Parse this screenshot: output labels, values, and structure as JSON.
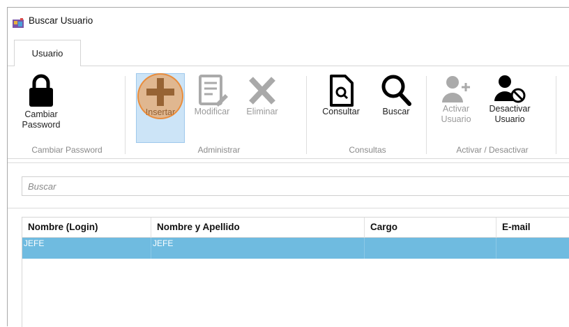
{
  "window": {
    "title": "Buscar Usuario"
  },
  "tabs": [
    {
      "label": "Usuario"
    }
  ],
  "ribbon": {
    "groups": [
      {
        "label": "Cambiar Password",
        "buttons": [
          {
            "label1": "Cambiar",
            "label2": "Password",
            "icon": "lock-icon"
          }
        ]
      },
      {
        "label": "Administrar",
        "buttons": [
          {
            "label": "Insertar",
            "icon": "plus-icon",
            "state": "selected"
          },
          {
            "label": "Modificar",
            "icon": "edit-icon",
            "state": "disabled"
          },
          {
            "label": "Eliminar",
            "icon": "close-icon",
            "state": "disabled"
          }
        ]
      },
      {
        "label": "Consultas",
        "buttons": [
          {
            "label": "Consultar",
            "icon": "document-search-icon"
          },
          {
            "label": "Buscar",
            "icon": "search-icon"
          }
        ]
      },
      {
        "label": "Activar / Desactivar",
        "buttons": [
          {
            "label1": "Activar",
            "label2": "Usuario",
            "icon": "user-add-icon",
            "state": "disabled"
          },
          {
            "label1": "Desactivar",
            "label2": "Usuario",
            "icon": "user-block-icon"
          }
        ]
      }
    ]
  },
  "search": {
    "placeholder": "Buscar",
    "value": ""
  },
  "table": {
    "columns": [
      "Nombre (Login)",
      "Nombre y Apellido",
      "Cargo",
      "E-mail"
    ],
    "rows": [
      {
        "login": "JEFE",
        "nombre": "JEFE",
        "cargo": "",
        "email": ""
      }
    ]
  },
  "colors": {
    "selection": "#6fbbe0",
    "ribbon_selected": "#cce4f7",
    "click_indicator": "#f0913c"
  }
}
